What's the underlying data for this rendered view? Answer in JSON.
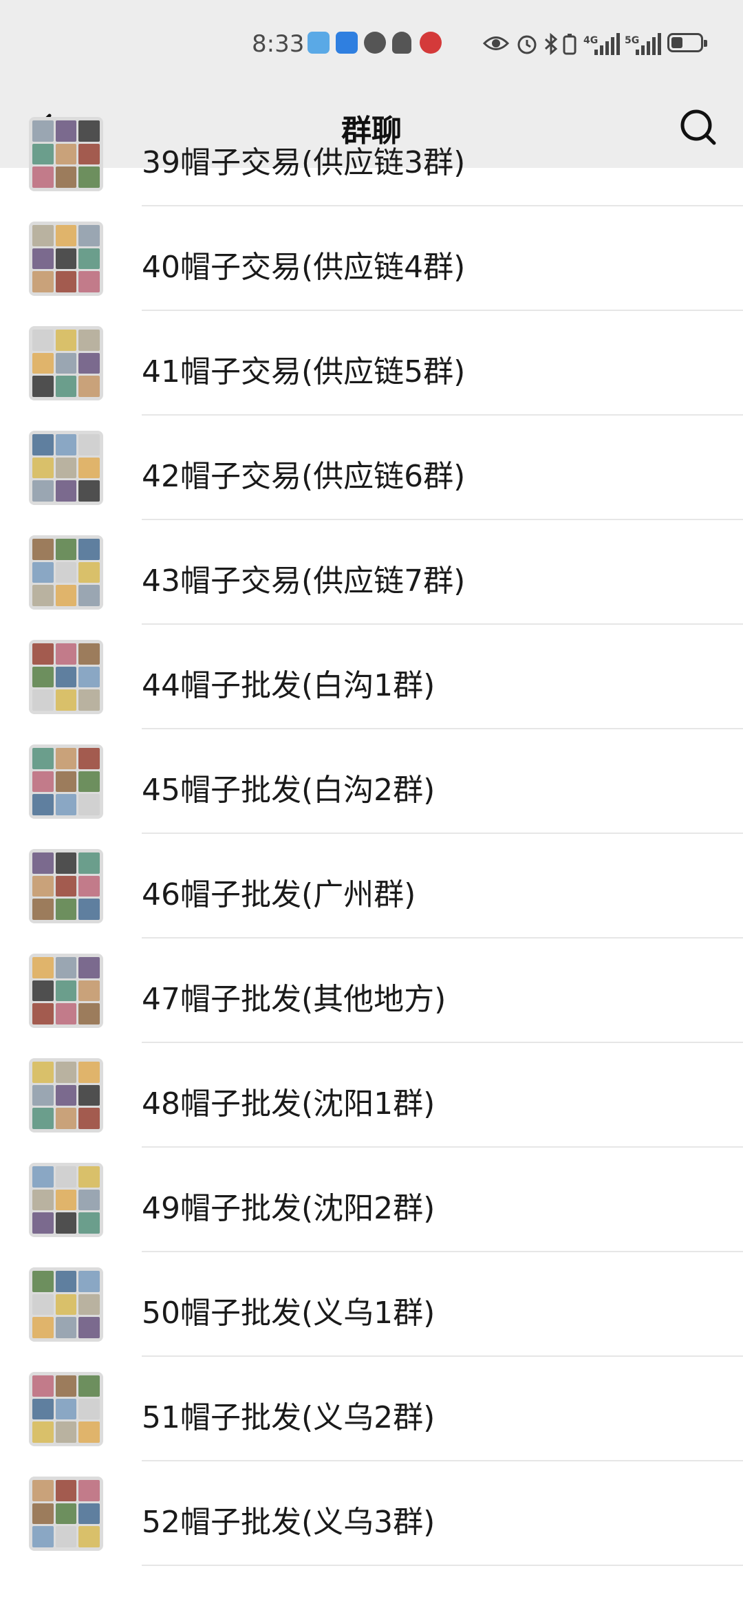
{
  "status_bar": {
    "time": "8:33",
    "network_1": "4G",
    "network_2": "5G",
    "icons": [
      "reader-app-icon",
      "app-icon",
      "chat-bubble-icon",
      "bell-icon",
      "bank-app-icon",
      "eye-icon",
      "alarm-icon",
      "bluetooth-icon",
      "battery-saver-icon",
      "signal-icon",
      "signal-icon",
      "battery-icon"
    ]
  },
  "nav": {
    "title": "群聊",
    "back_icon": "chevron-left-icon",
    "search_icon": "search-icon"
  },
  "groups": [
    {
      "name": "39帽子交易(供应链3群)"
    },
    {
      "name": "40帽子交易(供应链4群)"
    },
    {
      "name": "41帽子交易(供应链5群)"
    },
    {
      "name": "42帽子交易(供应链6群)"
    },
    {
      "name": "43帽子交易(供应链7群)"
    },
    {
      "name": "44帽子批发(白沟1群)"
    },
    {
      "name": "45帽子批发(白沟2群)"
    },
    {
      "name": "46帽子批发(广州群)"
    },
    {
      "name": "47帽子批发(其他地方)"
    },
    {
      "name": "48帽子批发(沈阳1群)"
    },
    {
      "name": "49帽子批发(沈阳2群)"
    },
    {
      "name": "50帽子批发(义乌1群)"
    },
    {
      "name": "51帽子批发(义乌2群)"
    },
    {
      "name": "52帽子批发(义乌3群)"
    }
  ],
  "colors": {
    "header_bg": "#ededed",
    "text": "#1a1a1a",
    "divider": "#e6e6e6"
  }
}
